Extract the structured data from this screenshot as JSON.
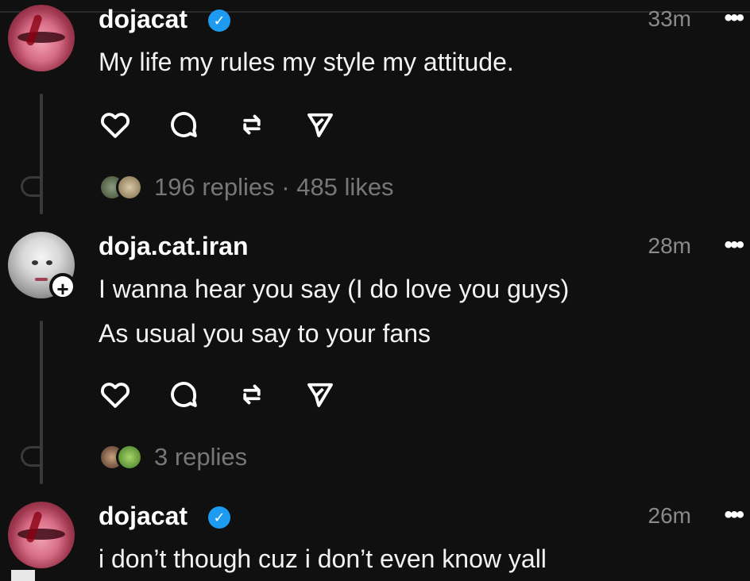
{
  "posts": [
    {
      "username": "dojacat",
      "verified": true,
      "time": "33m",
      "more": "•••",
      "lines": [
        "My life my rules my style my attitude."
      ],
      "meta": "196 replies · 485 likes"
    },
    {
      "username": "doja.cat.iran",
      "verified": false,
      "time": "28m",
      "more": "•••",
      "follow_symbol": "+",
      "lines": [
        "I wanna hear you say (I do love you guys)",
        "As usual you say to your fans"
      ],
      "meta": "3 replies"
    },
    {
      "username": "dojacat",
      "verified": true,
      "time": "26m",
      "more": "•••",
      "lines": [
        "i don’t though cuz i don’t even know yall"
      ]
    }
  ],
  "icons": [
    "heart-icon",
    "comment-icon",
    "repost-icon",
    "share-icon"
  ],
  "colors": {
    "background": "#101010",
    "verified": "#1d9bf0",
    "muted_text": "#8a8a8a"
  }
}
